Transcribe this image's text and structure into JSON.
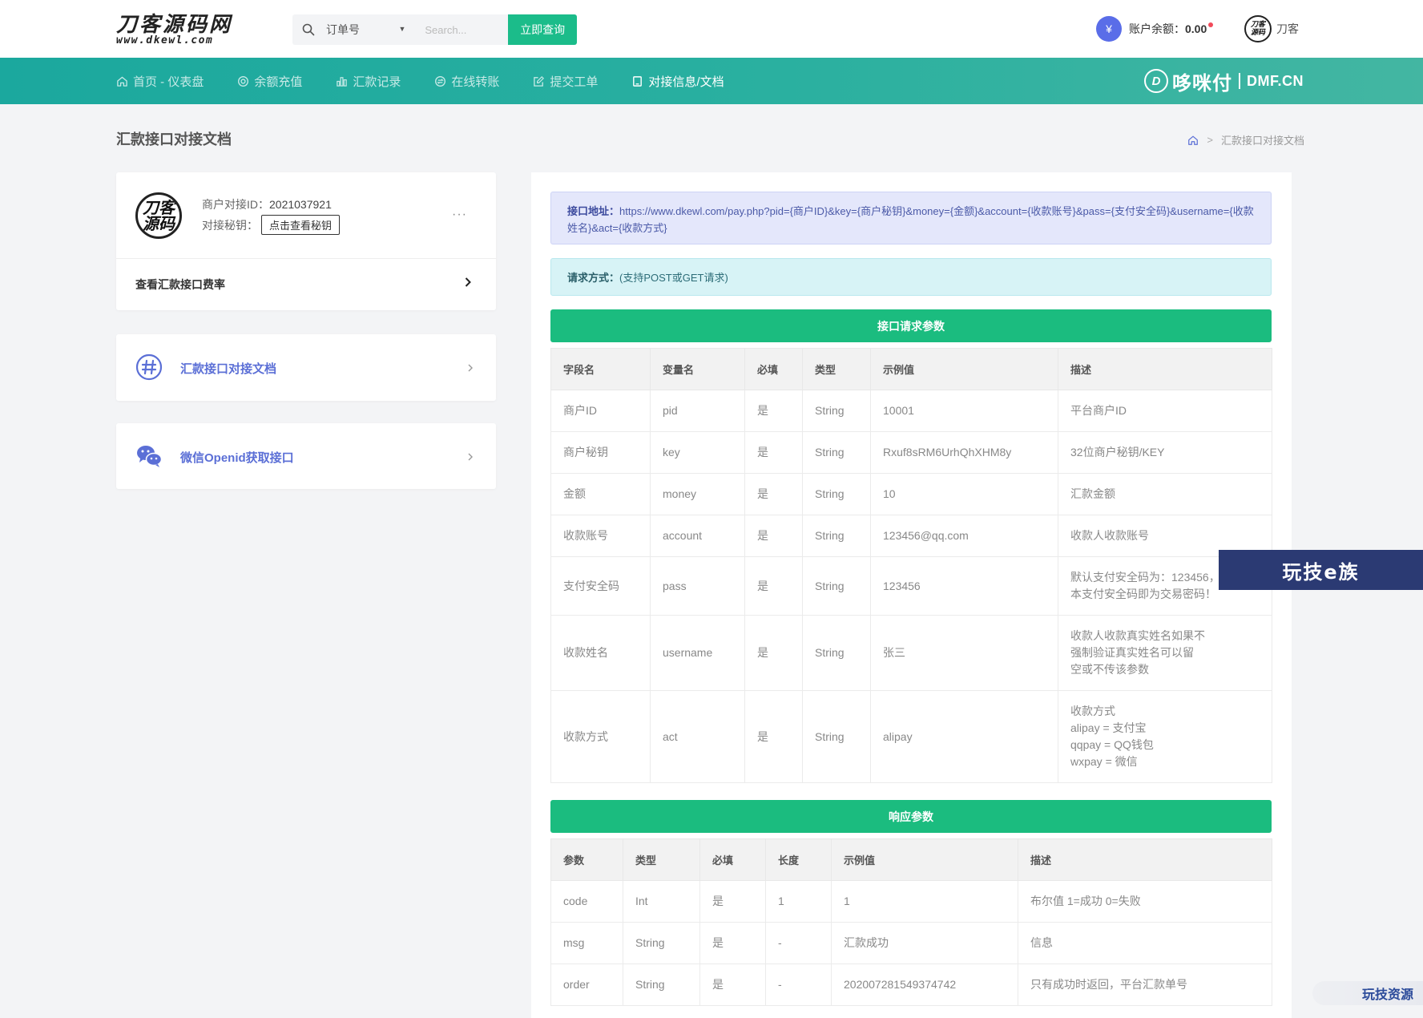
{
  "header": {
    "logo_main": "刀客源码网",
    "logo_sub": "www.dkewl.com",
    "search": {
      "select_label": "订单号",
      "placeholder": "Search...",
      "button_label": "立即查询"
    },
    "balance_label": "账户余额：",
    "balance_value": "0.00",
    "username": "刀客",
    "avatar_text": "刀客源码"
  },
  "nav": {
    "items": [
      {
        "label": "首页 - 仪表盘",
        "icon": "home-icon"
      },
      {
        "label": "余额充值",
        "icon": "coin-icon"
      },
      {
        "label": "汇款记录",
        "icon": "bar-chart-icon"
      },
      {
        "label": "在线转账",
        "icon": "transfer-icon"
      },
      {
        "label": "提交工单",
        "icon": "edit-icon"
      },
      {
        "label": "对接信息/文档",
        "icon": "document-icon"
      }
    ],
    "brand_cn": "哆咪付",
    "brand_en": "DMF.CN",
    "brand_mark": "D"
  },
  "page": {
    "title": "汇款接口对接文档",
    "breadcrumb_current": "汇款接口对接文档",
    "breadcrumb_sep": ">"
  },
  "profile": {
    "merchant_label": "商户对接ID：",
    "merchant_id": "2021037921",
    "key_label": "对接秘钥：",
    "key_button": "点击查看秘钥",
    "more": "···",
    "rate_link": "查看汇款接口费率"
  },
  "links": {
    "doc": "汇款接口对接文档",
    "openid": "微信Openid获取接口"
  },
  "doc": {
    "url_label": "接口地址：",
    "url_text": "https://www.dkewl.com/pay.php?pid={商户ID}&key={商户秘钥}&money={金额}&account={收款账号}&pass={支付安全码}&username={收款姓名}&act={收款方式}",
    "method_label": "请求方式：",
    "method_text": "(支持POST或GET请求)",
    "request_title": "接口请求参数",
    "response_title": "响应参数",
    "request_headers": [
      "字段名",
      "变量名",
      "必填",
      "类型",
      "示例值",
      "描述"
    ],
    "request_rows": [
      [
        "商户ID",
        "pid",
        "是",
        "String",
        "10001",
        "平台商户ID"
      ],
      [
        "商户秘钥",
        "key",
        "是",
        "String",
        "Rxuf8sRM6UrhQhXHM8y",
        "32位商户秘钥/KEY"
      ],
      [
        "金额",
        "money",
        "是",
        "String",
        "10",
        "汇款金额"
      ],
      [
        "收款账号",
        "account",
        "是",
        "String",
        "123456@qq.com",
        "收款人收款账号"
      ],
      [
        "支付安全码",
        "pass",
        "是",
        "String",
        "123456",
        "默认支付安全码为：123456，|本支付安全码即为交易密码！"
      ],
      [
        "收款姓名",
        "username",
        "是",
        "String",
        "张三",
        "收款人收款真实姓名如果不|强制验证真实姓名可以留|空或不传该参数"
      ],
      [
        "收款方式",
        "act",
        "是",
        "String",
        "alipay",
        "收款方式|alipay = 支付宝|qqpay = QQ钱包|wxpay = 微信"
      ]
    ],
    "response_headers": [
      "参数",
      "类型",
      "必填",
      "长度",
      "示例值",
      "描述"
    ],
    "response_rows": [
      [
        "code",
        "Int",
        "是",
        "1",
        "1",
        "布尔值 1=成功 0=失败"
      ],
      [
        "msg",
        "String",
        "是",
        "-",
        "汇款成功",
        "信息"
      ],
      [
        "order",
        "String",
        "是",
        "-",
        "202007281549374742",
        "只有成功时返回，平台汇款单号"
      ]
    ]
  },
  "watermark": {
    "main": "玩技e族",
    "corner": "玩技资源"
  },
  "colors": {
    "accent_green": "#1bbc7f",
    "nav_teal": "#1ba89e",
    "link_blue": "#5b6fd6",
    "balance_icon": "#5a6de8"
  }
}
